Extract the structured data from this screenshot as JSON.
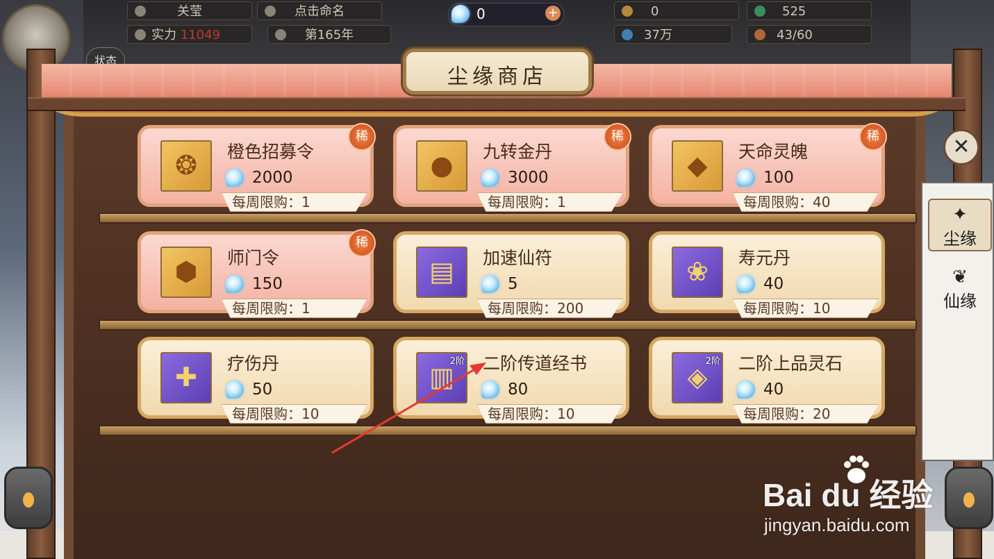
{
  "hud": {
    "name": "关莹",
    "nickname_action": "点击命名",
    "power_label": "实力",
    "power_value": "11049",
    "year": "第165年",
    "status_label": "状态",
    "spirit_currency": "0",
    "res1": "0",
    "res2": "525",
    "res3": "37万",
    "res4": "43/60"
  },
  "shop": {
    "title": "尘缘商店",
    "limit_prefix": "每周限购：",
    "rare_badge": "稀",
    "items": [
      {
        "name": "橙色招募令",
        "price": "2000",
        "limit": "每周限购：1",
        "rare": true,
        "icon": "recruit-token-icon"
      },
      {
        "name": "九转金丹",
        "price": "3000",
        "limit": "每周限购：1",
        "rare": true,
        "icon": "golden-pill-icon"
      },
      {
        "name": "天命灵魄",
        "price": "100",
        "limit": "每周限购：40",
        "rare": true,
        "icon": "spirit-soul-icon"
      },
      {
        "name": "师门令",
        "price": "150",
        "limit": "每周限购：1",
        "rare": true,
        "icon": "sect-token-icon"
      },
      {
        "name": "加速仙符",
        "price": "5",
        "limit": "每周限购：200",
        "rare": false,
        "icon": "speed-talisman-icon"
      },
      {
        "name": "寿元丹",
        "price": "40",
        "limit": "每周限购：10",
        "rare": false,
        "icon": "longevity-pill-icon"
      },
      {
        "name": "疗伤丹",
        "price": "50",
        "limit": "每周限购：10",
        "rare": false,
        "icon": "healing-pill-icon"
      },
      {
        "name": "二阶传道经书",
        "price": "80",
        "limit": "每周限购：10",
        "rare": false,
        "tier": "2阶",
        "icon": "scripture-scroll-icon"
      },
      {
        "name": "二阶上品灵石",
        "price": "40",
        "limit": "每周限购：20",
        "rare": false,
        "tier": "2阶",
        "icon": "spirit-stone-chest-icon"
      }
    ]
  },
  "tabs": [
    {
      "label": "尘缘",
      "active": true,
      "icon": "dust-fate-icon"
    },
    {
      "label": "仙缘",
      "active": false,
      "icon": "immortal-fate-icon"
    }
  ],
  "close_icon": "close-icon",
  "watermark": {
    "logo": "Bai du 经验",
    "url": "jingyan.baidu.com"
  },
  "colors": {
    "rare_card": "#f4b2a3",
    "normal_card": "#f1d9ae",
    "arrow": "#e53935"
  }
}
